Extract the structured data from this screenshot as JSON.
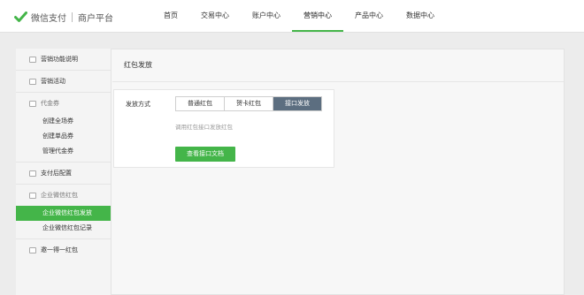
{
  "brand": {
    "name": "微信支付",
    "subtitle": "商户平台",
    "icon": "wechat-pay-logo-icon",
    "accent": "#44b549"
  },
  "nav": {
    "items": [
      {
        "label": "首页"
      },
      {
        "label": "交易中心"
      },
      {
        "label": "账户中心"
      },
      {
        "label": "营销中心",
        "active": true
      },
      {
        "label": "产品中心"
      },
      {
        "label": "数据中心"
      }
    ]
  },
  "sidebar": {
    "groups": [
      {
        "label": "营销功能说明",
        "icon": "info-icon"
      },
      {
        "label": "营销活动",
        "icon": "gift-icon"
      },
      {
        "label": "代金券",
        "icon": "coupon-icon",
        "items": [
          "创建全场券",
          "创建单品券",
          "管理代金券"
        ]
      },
      {
        "label": "支付后配置",
        "icon": "settings-doc-icon"
      },
      {
        "label": "企业微信红包",
        "icon": "red-packet-icon",
        "items": [
          "企业微信红包发放",
          "企业微信红包记录"
        ],
        "active_item": "企业微信红包发放"
      },
      {
        "label": "邀一得一红包",
        "icon": "invite-icon"
      }
    ]
  },
  "main": {
    "title": "红包发放",
    "method_label": "发放方式",
    "tabs": [
      "普通红包",
      "贺卡红包",
      "接口发放"
    ],
    "active_tab": "接口发放",
    "hint": "调用红包接口发放红包",
    "doc_button": "查看接口文档"
  }
}
